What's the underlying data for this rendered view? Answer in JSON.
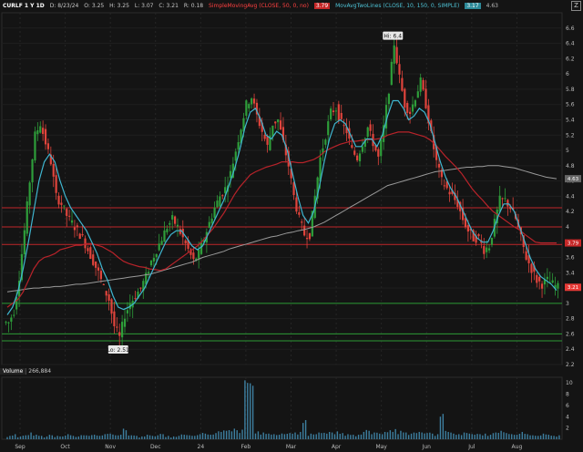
{
  "header": {
    "symbol": "CURLF 1 Y 1D",
    "date": "D: 8/23/24",
    "open": "O: 3.25",
    "high": "H: 3.25",
    "low": "L: 3.07",
    "close": "C: 3.21",
    "range": "R: 0.18",
    "sma_label": "SimpleMovingAvg (CLOSE, 50, 0, no)",
    "sma_value": "3.79",
    "ma_label": "MovAvgTwoLines (CLOSE, 10, 150, 0, SIMPLE)",
    "ma_value1": "3.17",
    "ma_value2": "4.63"
  },
  "volume_panel": {
    "title": "Volume",
    "value": "266,884"
  },
  "colors": {
    "up": "#2e9e3a",
    "down": "#e0443c",
    "sma50": "#b8232a",
    "ma10": "#3fb6d0",
    "ma150": "#9a9a9a",
    "resistance": "#c0262a",
    "support": "#2b9a34",
    "volume": "#3d7fa0"
  },
  "chart_data": [
    {
      "type": "candlestick",
      "title": "CURLF 1 Y 1D",
      "ylim": [
        2.2,
        6.8
      ],
      "yticks": [
        "6.6",
        "6.4",
        "6.2",
        "6",
        "5.8",
        "5.6",
        "5.4",
        "5.2",
        "5",
        "4.8",
        "4.6",
        "4.4",
        "4.2",
        "4",
        "3.8",
        "3.6",
        "3.4",
        "3.2",
        "3",
        "2.8",
        "2.6",
        "2.4",
        "2.2"
      ],
      "xticks": [
        "Sep",
        "Oct",
        "Nov",
        "Dec",
        "24",
        "Feb",
        "Mar",
        "Apr",
        "May",
        "Jun",
        "Jul",
        "Aug"
      ],
      "annotations": [
        {
          "text": "Hi: 6.4",
          "value": 6.4
        },
        {
          "text": "Lo: 2.51",
          "value": 2.51
        }
      ],
      "price_badges": [
        {
          "text": "4.63",
          "value": 4.63,
          "color": "#666666"
        },
        {
          "text": "3.79",
          "value": 3.79,
          "color": "#c62828"
        },
        {
          "text": "3.21",
          "value": 3.21,
          "color": "#e53935"
        }
      ],
      "horizontal_lines": {
        "red": [
          4.25,
          4.0,
          3.77
        ],
        "green": [
          3.0,
          2.6,
          2.51
        ]
      },
      "close_path": [
        2.75,
        2.9,
        3.35,
        3.95,
        4.6,
        5.2,
        5.35,
        5.1,
        4.85,
        4.4,
        4.3,
        4.15,
        4.05,
        3.95,
        3.85,
        3.7,
        3.55,
        3.4,
        3.2,
        3.05,
        2.7,
        2.55,
        2.85,
        3.0,
        3.1,
        3.2,
        3.35,
        3.55,
        3.7,
        3.85,
        4.0,
        4.1,
        4.0,
        3.85,
        3.7,
        3.55,
        3.65,
        3.85,
        4.05,
        4.25,
        4.4,
        4.5,
        4.7,
        5.0,
        5.3,
        5.6,
        5.7,
        5.45,
        5.25,
        5.05,
        5.35,
        5.4,
        5.1,
        4.8,
        4.4,
        4.1,
        3.9,
        3.9,
        4.4,
        4.9,
        5.2,
        5.5,
        5.55,
        5.35,
        5.25,
        5.0,
        4.9,
        5.1,
        5.3,
        5.1,
        4.9,
        5.3,
        5.8,
        6.4,
        5.95,
        5.6,
        5.5,
        5.7,
        5.9,
        5.6,
        5.2,
        4.85,
        4.6,
        4.5,
        4.4,
        4.3,
        4.1,
        3.95,
        3.85,
        3.85,
        3.7,
        3.75,
        4.05,
        4.35,
        4.35,
        4.25,
        4.1,
        3.85,
        3.6,
        3.45,
        3.3,
        3.25,
        3.3,
        3.25,
        3.21
      ],
      "ma10_path": [
        2.85,
        2.95,
        3.15,
        3.45,
        3.8,
        4.2,
        4.6,
        4.85,
        4.95,
        4.85,
        4.6,
        4.4,
        4.25,
        4.15,
        4.05,
        3.95,
        3.8,
        3.65,
        3.45,
        3.3,
        3.1,
        2.95,
        2.92,
        2.95,
        3.0,
        3.1,
        3.2,
        3.35,
        3.5,
        3.65,
        3.8,
        3.9,
        3.95,
        3.95,
        3.85,
        3.75,
        3.7,
        3.75,
        3.9,
        4.05,
        4.2,
        4.35,
        4.55,
        4.75,
        5.0,
        5.3,
        5.5,
        5.55,
        5.4,
        5.2,
        5.15,
        5.25,
        5.2,
        5.0,
        4.7,
        4.4,
        4.15,
        4.05,
        4.2,
        4.5,
        4.85,
        5.15,
        5.35,
        5.4,
        5.35,
        5.2,
        5.05,
        5.05,
        5.15,
        5.15,
        5.05,
        5.2,
        5.45,
        5.65,
        5.65,
        5.55,
        5.4,
        5.45,
        5.55,
        5.5,
        5.35,
        5.1,
        4.85,
        4.65,
        4.5,
        4.4,
        4.25,
        4.1,
        3.95,
        3.85,
        3.8,
        3.8,
        3.95,
        4.15,
        4.3,
        4.3,
        4.2,
        4.0,
        3.8,
        3.6,
        3.45,
        3.35,
        3.3,
        3.25,
        3.17
      ],
      "sma50_path": [
        2.95,
        3.0,
        3.05,
        3.15,
        3.3,
        3.45,
        3.55,
        3.6,
        3.62,
        3.65,
        3.7,
        3.72,
        3.74,
        3.76,
        3.76,
        3.78,
        3.78,
        3.76,
        3.74,
        3.7,
        3.66,
        3.6,
        3.55,
        3.52,
        3.5,
        3.48,
        3.47,
        3.45,
        3.44,
        3.43,
        3.45,
        3.5,
        3.55,
        3.6,
        3.65,
        3.7,
        3.75,
        3.82,
        3.9,
        3.98,
        4.08,
        4.18,
        4.3,
        4.42,
        4.52,
        4.6,
        4.68,
        4.72,
        4.75,
        4.78,
        4.8,
        4.82,
        4.85,
        4.85,
        4.85,
        4.84,
        4.84,
        4.86,
        4.88,
        4.92,
        4.98,
        5.02,
        5.05,
        5.08,
        5.1,
        5.12,
        5.12,
        5.13,
        5.14,
        5.14,
        5.15,
        5.16,
        5.2,
        5.22,
        5.24,
        5.24,
        5.24,
        5.22,
        5.2,
        5.18,
        5.14,
        5.08,
        5.0,
        4.92,
        4.85,
        4.78,
        4.7,
        4.6,
        4.5,
        4.42,
        4.35,
        4.27,
        4.2,
        4.15,
        4.1,
        4.05,
        4.0,
        3.96,
        3.9,
        3.85,
        3.8,
        3.79,
        3.79,
        3.79,
        3.79
      ],
      "ma150_path": [
        3.15,
        3.16,
        3.17,
        3.18,
        3.19,
        3.2,
        3.2,
        3.21,
        3.21,
        3.22,
        3.22,
        3.23,
        3.24,
        3.25,
        3.25,
        3.26,
        3.27,
        3.28,
        3.29,
        3.3,
        3.31,
        3.32,
        3.33,
        3.34,
        3.35,
        3.36,
        3.37,
        3.38,
        3.4,
        3.42,
        3.44,
        3.46,
        3.48,
        3.5,
        3.52,
        3.54,
        3.57,
        3.6,
        3.62,
        3.64,
        3.66,
        3.68,
        3.71,
        3.73,
        3.75,
        3.77,
        3.79,
        3.81,
        3.83,
        3.85,
        3.87,
        3.88,
        3.9,
        3.92,
        3.93,
        3.95,
        3.96,
        3.98,
        4.0,
        4.03,
        4.06,
        4.1,
        4.14,
        4.18,
        4.22,
        4.26,
        4.3,
        4.34,
        4.38,
        4.42,
        4.46,
        4.5,
        4.54,
        4.56,
        4.58,
        4.6,
        4.62,
        4.64,
        4.66,
        4.68,
        4.7,
        4.72,
        4.73,
        4.74,
        4.75,
        4.76,
        4.77,
        4.78,
        4.78,
        4.79,
        4.79,
        4.8,
        4.8,
        4.8,
        4.79,
        4.78,
        4.77,
        4.75,
        4.73,
        4.71,
        4.69,
        4.67,
        4.65,
        4.64,
        4.63
      ]
    },
    {
      "type": "bar",
      "title": "Volume",
      "yticks": [
        "10",
        "8",
        "6",
        "4",
        "2"
      ],
      "ylim": [
        0,
        11
      ],
      "spikes": [
        0.6,
        0.9,
        0.5,
        0.7,
        1.2,
        0.8,
        0.6,
        0.5,
        0.7,
        0.6,
        0.5,
        0.9,
        0.6,
        0.5,
        0.7,
        0.6,
        0.8,
        0.6,
        0.9,
        1.0,
        0.7,
        0.8,
        1.6,
        0.7,
        0.6,
        0.5,
        0.8,
        0.6,
        0.7,
        0.9,
        0.6,
        0.5,
        0.6,
        0.8,
        0.7,
        0.6,
        0.9,
        1.0,
        0.8,
        1.1,
        1.3,
        1.5,
        1.4,
        1.6,
        1.7,
        10.0,
        9.5,
        1.4,
        1.2,
        1.0,
        0.9,
        0.8,
        0.9,
        1.1,
        1.2,
        1.3,
        3.4,
        1.0,
        0.9,
        1.1,
        1.0,
        1.2,
        1.4,
        1.1,
        0.9,
        0.8,
        0.8,
        1.3,
        1.5,
        1.2,
        1.0,
        1.3,
        1.6,
        1.8,
        1.5,
        1.2,
        1.0,
        1.1,
        1.2,
        1.1,
        1.0,
        0.9,
        4.5,
        1.3,
        1.0,
        0.9,
        1.2,
        1.0,
        0.8,
        0.9,
        1.0,
        0.8,
        1.2,
        1.5,
        1.1,
        0.9,
        0.8,
        1.3,
        0.9,
        0.7,
        0.6,
        1.0,
        0.8,
        0.6,
        0.7
      ]
    }
  ]
}
